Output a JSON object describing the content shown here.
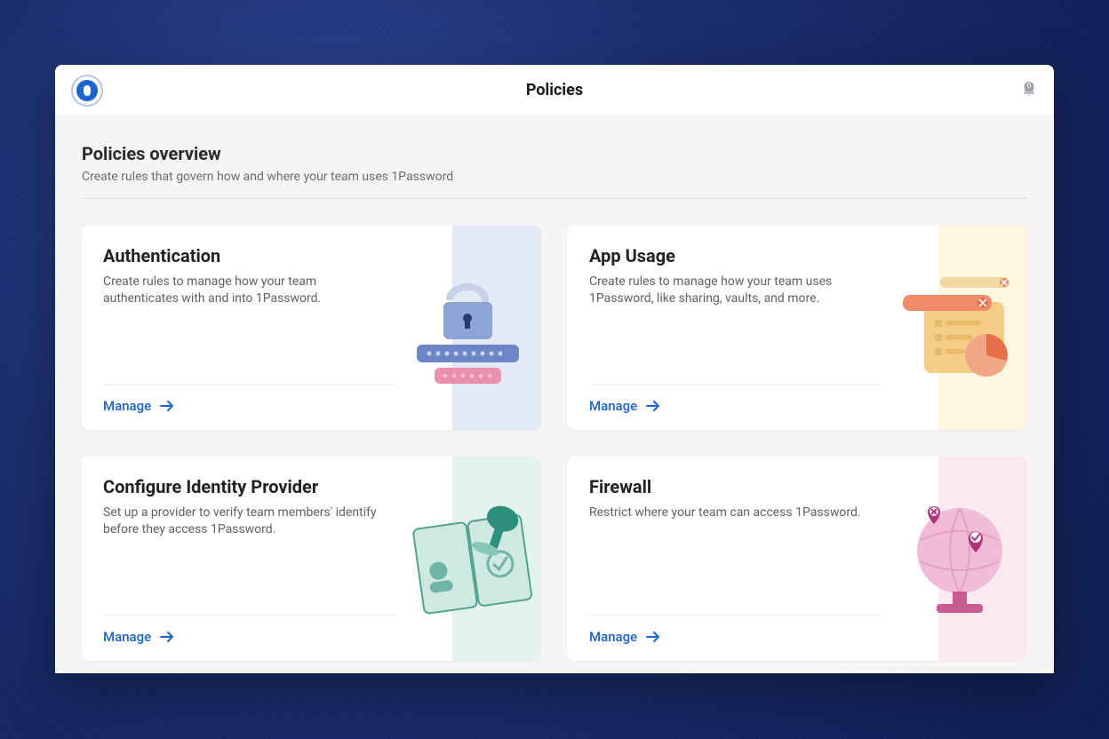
{
  "header": {
    "title": "Policies",
    "notification_count": "0"
  },
  "overview": {
    "title": "Policies overview",
    "subtitle": "Create rules that govern how and where your team uses 1Password"
  },
  "cards": {
    "authentication": {
      "title": "Authentication",
      "description": "Create rules to manage how your team authenticates with and into 1Password.",
      "action": "Manage"
    },
    "app_usage": {
      "title": "App Usage",
      "description": "Create rules to manage how your team uses 1Password, like sharing, vaults, and more.",
      "action": "Manage"
    },
    "identity_provider": {
      "title": "Configure Identity Provider",
      "description": "Set up a provider to verify team members' identify before they access 1Password.",
      "action": "Manage"
    },
    "firewall": {
      "title": "Firewall",
      "description": "Restrict where your team can access 1Password.",
      "action": "Manage"
    }
  }
}
